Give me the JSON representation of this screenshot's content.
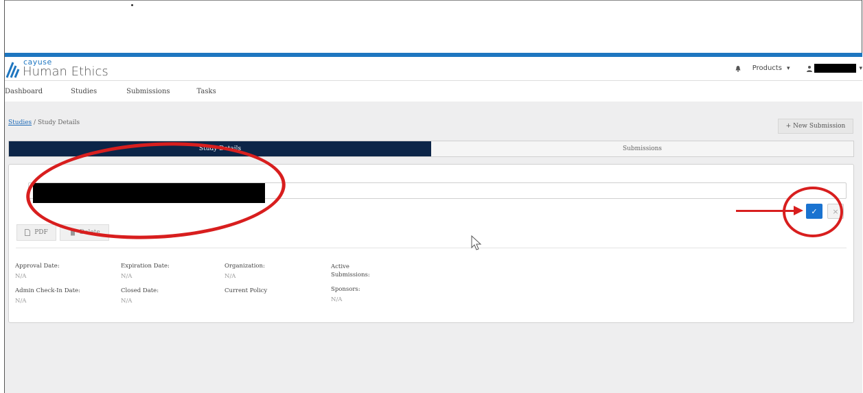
{
  "brand": {
    "small": "cayuse",
    "name": "Human Ethics",
    "accent": "#1e76c0"
  },
  "header": {
    "bell_icon": "bell-icon",
    "products_label": "Products",
    "products_chevron": "▾",
    "user_icon": "user-icon",
    "user_chevron": "▾"
  },
  "nav": {
    "items": [
      {
        "label": "Dashboard"
      },
      {
        "label": "Studies"
      },
      {
        "label": "Submissions"
      },
      {
        "label": "Tasks"
      }
    ]
  },
  "breadcrumb": {
    "link": "Studies",
    "separator": " / ",
    "current": "Study Details"
  },
  "actions": {
    "new_submission": "+ New Submission"
  },
  "tabs": {
    "active": "Study Details",
    "inactive": "Submissions",
    "active_color": "#0c2548"
  },
  "study": {
    "title_placeholder": "",
    "confirm_symbol": "✓",
    "cancel_symbol": "×",
    "pdf_label": "PDF",
    "delete_label": "Delete"
  },
  "fields": {
    "approval_date": {
      "label": "Approval Date:",
      "value": "N/A"
    },
    "expiration_date": {
      "label": "Expiration Date:",
      "value": "N/A"
    },
    "organization": {
      "label": "Organization:",
      "value": "N/A"
    },
    "active_submissions": {
      "label": "Active Submissions:",
      "value": ""
    },
    "admin_checkin_date": {
      "label": "Admin Check-In Date:",
      "value": "N/A"
    },
    "closed_date": {
      "label": "Closed Date:",
      "value": "N/A"
    },
    "current_policy": {
      "label": "Current Policy",
      "value": ""
    },
    "sponsors": {
      "label": "Sponsors:",
      "value": "N/A"
    }
  },
  "annotation_color": "#d81e1e"
}
